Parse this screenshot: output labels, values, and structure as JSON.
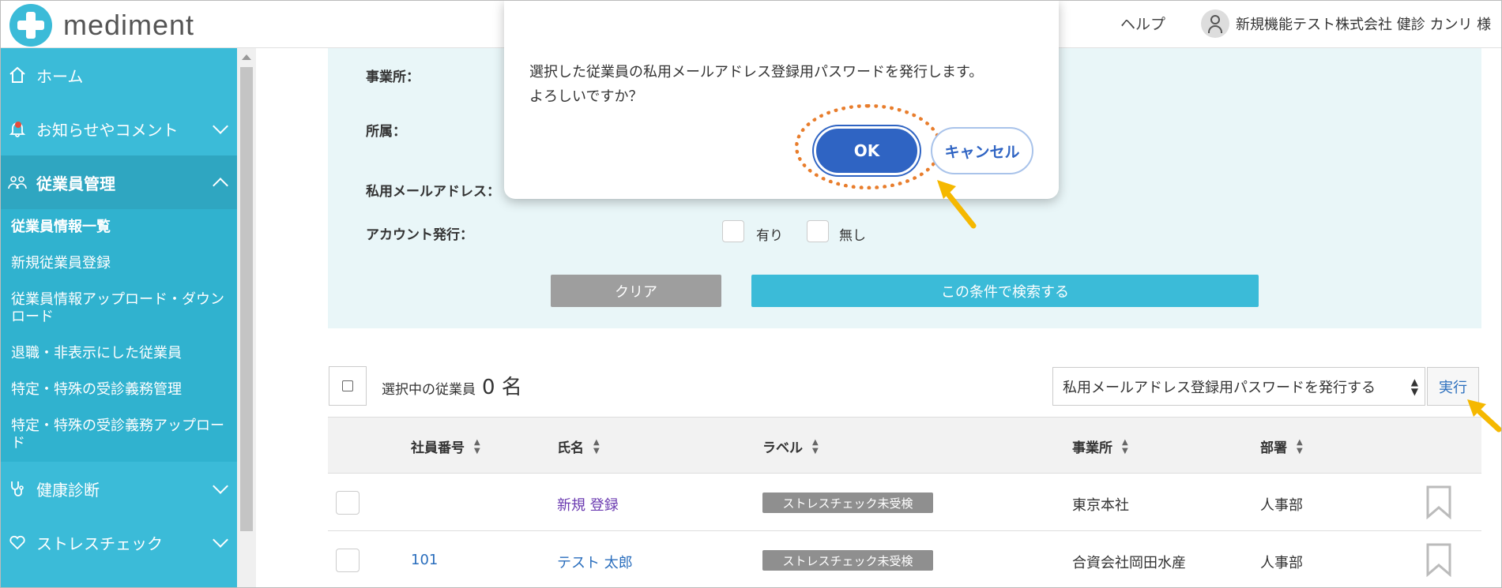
{
  "header": {
    "logo_text": "mediment",
    "help_label": "ヘルプ",
    "user_name": "新規機能テスト株式会社 健診 カンリ 様"
  },
  "sidebar": {
    "items": [
      {
        "label": "ホーム"
      },
      {
        "label": "お知らせやコメント"
      },
      {
        "label": "従業員管理"
      },
      {
        "label": "健康診断"
      },
      {
        "label": "ストレスチェック"
      }
    ],
    "sub_items": [
      {
        "label": "従業員情報一覧"
      },
      {
        "label": "新規従業員登録"
      },
      {
        "label": "従業員情報アップロード・ダウンロード"
      },
      {
        "label": "退職・非表示にした従業員"
      },
      {
        "label": "特定・特殊の受診義務管理"
      },
      {
        "label": "特定・特殊の受診義務アップロード"
      }
    ]
  },
  "filter": {
    "office_label": "事業所：",
    "department_label": "所属：",
    "email_label": "私用メールアドレス：",
    "account_label": "アカウント発行：",
    "yes_label": "有り",
    "no_label": "無し",
    "clear_label": "クリア",
    "search_label": "この条件で検索する"
  },
  "selection": {
    "label": "選択中の従業員",
    "count": "0 名",
    "action_value": "私用メールアドレス登録用パスワードを発行する",
    "execute_label": "実行"
  },
  "table": {
    "headers": {
      "employee_no": "社員番号",
      "name": "氏名",
      "label": "ラベル",
      "office": "事業所",
      "department": "部署"
    },
    "rows": [
      {
        "employee_no": "",
        "name": "新規 登録",
        "label": "ストレスチェック未受検",
        "office": "東京本社",
        "department": "人事部"
      },
      {
        "employee_no": "101",
        "name": "テスト 太郎",
        "label": "ストレスチェック未受検",
        "office": "合資会社岡田水産",
        "department": "人事部"
      }
    ]
  },
  "dialog": {
    "message_line1": "選択した従業員の私用メールアドレス登録用パスワードを発行します。",
    "message_line2": "よろしいですか？",
    "ok_label": "OK",
    "cancel_label": "キャンセル"
  },
  "colors": {
    "brand": "#3bbbd8",
    "primary_button": "#2f64c3",
    "highlight_ring": "#e87d2c",
    "pointer_arrow": "#f5b800"
  },
  "icons": [
    "home-icon",
    "bell-icon",
    "people-icon",
    "stethoscope-icon",
    "heart-icon",
    "user-icon",
    "bookmark-icon",
    "sort-icon",
    "pointer-arrow-icon"
  ]
}
